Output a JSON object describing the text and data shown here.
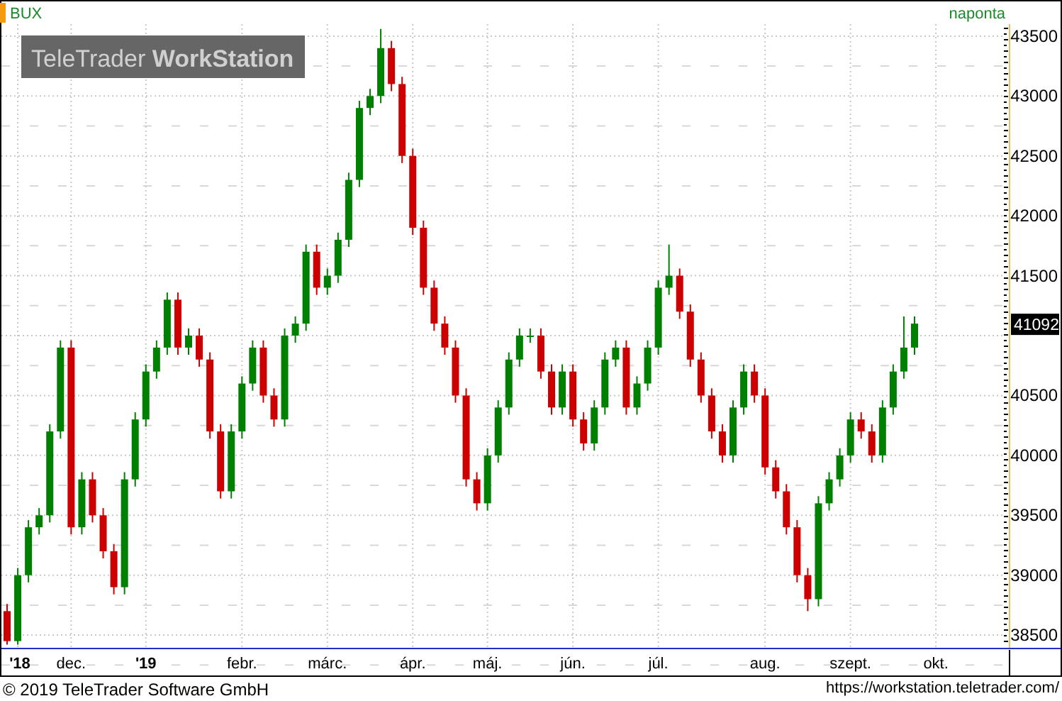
{
  "chart": {
    "interval": "naponta",
    "logo": {
      "light": "TeleTrader",
      "bold": "WorkStation"
    },
    "last_price": "41092",
    "chart_data": {
      "type": "candlestick",
      "title": "BUX",
      "grid": true,
      "ylim": [
        38400,
        43600
      ],
      "yticks": [
        38500,
        39000,
        39500,
        40000,
        40500,
        41500,
        42000,
        42500,
        43000,
        43500
      ],
      "categories": [
        null,
        "'18",
        null,
        null,
        null,
        null,
        "dec.",
        null,
        null,
        null,
        null,
        null,
        null,
        "'19",
        null,
        null,
        null,
        null,
        null,
        null,
        null,
        null,
        "febr.",
        null,
        null,
        null,
        null,
        null,
        null,
        null,
        "márc.",
        null,
        null,
        null,
        null,
        null,
        null,
        null,
        "ápr.",
        null,
        null,
        null,
        null,
        null,
        null,
        "máj.",
        null,
        null,
        null,
        null,
        null,
        null,
        null,
        "jún.",
        null,
        null,
        null,
        null,
        null,
        null,
        null,
        "júl.",
        null,
        null,
        null,
        null,
        null,
        null,
        null,
        null,
        null,
        "aug.",
        null,
        null,
        null,
        null,
        null,
        null,
        null,
        "szept.",
        null,
        null,
        null,
        null,
        null,
        null,
        null,
        "okt."
      ],
      "ohlc": [
        [
          38700,
          38760,
          38420,
          38450
        ],
        [
          38450,
          39060,
          38420,
          39000
        ],
        [
          39000,
          39460,
          38940,
          39400
        ],
        [
          39400,
          39560,
          39340,
          39500
        ],
        [
          39500,
          40260,
          39440,
          40200
        ],
        [
          40200,
          40960,
          40140,
          40900
        ],
        [
          40900,
          40960,
          39340,
          39400
        ],
        [
          39400,
          39860,
          39340,
          39800
        ],
        [
          39800,
          39860,
          39440,
          39500
        ],
        [
          39500,
          39560,
          39140,
          39200
        ],
        [
          39200,
          39260,
          38840,
          38900
        ],
        [
          38900,
          39860,
          38840,
          39800
        ],
        [
          39800,
          40360,
          39740,
          40300
        ],
        [
          40300,
          40760,
          40240,
          40700
        ],
        [
          40700,
          40960,
          40640,
          40900
        ],
        [
          40900,
          41360,
          40840,
          41300
        ],
        [
          41300,
          41360,
          40840,
          40900
        ],
        [
          40900,
          41060,
          40840,
          41000
        ],
        [
          41000,
          41060,
          40740,
          40800
        ],
        [
          40800,
          40860,
          40140,
          40200
        ],
        [
          40200,
          40260,
          39640,
          39700
        ],
        [
          39700,
          40260,
          39640,
          40200
        ],
        [
          40200,
          40660,
          40140,
          40600
        ],
        [
          40600,
          40960,
          40540,
          40900
        ],
        [
          40900,
          40960,
          40440,
          40500
        ],
        [
          40500,
          40560,
          40240,
          40300
        ],
        [
          40300,
          41060,
          40240,
          41000
        ],
        [
          41000,
          41160,
          40940,
          41100
        ],
        [
          41100,
          41760,
          41040,
          41700
        ],
        [
          41700,
          41760,
          41340,
          41400
        ],
        [
          41400,
          41560,
          41340,
          41500
        ],
        [
          41500,
          41860,
          41440,
          41800
        ],
        [
          41800,
          42360,
          41740,
          42300
        ],
        [
          42300,
          42960,
          42240,
          42900
        ],
        [
          42900,
          43060,
          42840,
          43000
        ],
        [
          43000,
          43560,
          42940,
          43400
        ],
        [
          43400,
          43460,
          43040,
          43100
        ],
        [
          43100,
          43160,
          42440,
          42500
        ],
        [
          42500,
          42560,
          41840,
          41900
        ],
        [
          41900,
          41960,
          41340,
          41400
        ],
        [
          41400,
          41460,
          41040,
          41100
        ],
        [
          41100,
          41160,
          40840,
          40900
        ],
        [
          40900,
          40960,
          40440,
          40500
        ],
        [
          40500,
          40560,
          39740,
          39800
        ],
        [
          39800,
          39860,
          39540,
          39600
        ],
        [
          39600,
          40060,
          39540,
          40000
        ],
        [
          40000,
          40460,
          39940,
          40400
        ],
        [
          40400,
          40860,
          40340,
          40800
        ],
        [
          40800,
          41060,
          40740,
          41000
        ],
        [
          41000,
          41060,
          40940,
          41000
        ],
        [
          41000,
          41060,
          40640,
          40700
        ],
        [
          40700,
          40760,
          40340,
          40400
        ],
        [
          40400,
          40760,
          40340,
          40700
        ],
        [
          40700,
          40760,
          40240,
          40300
        ],
        [
          40300,
          40360,
          40040,
          40100
        ],
        [
          40100,
          40460,
          40040,
          40400
        ],
        [
          40400,
          40860,
          40340,
          40800
        ],
        [
          40800,
          40960,
          40740,
          40900
        ],
        [
          40900,
          40960,
          40340,
          40400
        ],
        [
          40400,
          40660,
          40340,
          40600
        ],
        [
          40600,
          40960,
          40540,
          40900
        ],
        [
          40900,
          41460,
          40840,
          41400
        ],
        [
          41400,
          41760,
          41340,
          41500
        ],
        [
          41500,
          41560,
          41140,
          41200
        ],
        [
          41200,
          41260,
          40740,
          40800
        ],
        [
          40800,
          40860,
          40440,
          40500
        ],
        [
          40500,
          40560,
          40140,
          40200
        ],
        [
          40200,
          40260,
          39940,
          40000
        ],
        [
          40000,
          40460,
          39940,
          40400
        ],
        [
          40400,
          40760,
          40340,
          40700
        ],
        [
          40700,
          40760,
          40440,
          40500
        ],
        [
          40500,
          40560,
          39840,
          39900
        ],
        [
          39900,
          39960,
          39640,
          39700
        ],
        [
          39700,
          39760,
          39340,
          39400
        ],
        [
          39400,
          39460,
          38940,
          39000
        ],
        [
          39000,
          39060,
          38700,
          38800
        ],
        [
          38800,
          39660,
          38740,
          39600
        ],
        [
          39600,
          39860,
          39540,
          39800
        ],
        [
          39800,
          40060,
          39740,
          40000
        ],
        [
          40000,
          40360,
          39940,
          40300
        ],
        [
          40300,
          40360,
          40140,
          40200
        ],
        [
          40200,
          40260,
          39940,
          40000
        ],
        [
          40000,
          40460,
          39940,
          40400
        ],
        [
          40400,
          40760,
          40340,
          40700
        ],
        [
          40700,
          41160,
          40640,
          40900
        ],
        [
          40900,
          41160,
          40840,
          41100
        ],
        null,
        null
      ]
    }
  },
  "footer": {
    "copyright": "© 2019 TeleTrader Software GmbH",
    "url": "https://workstation.teletrader.com/"
  }
}
